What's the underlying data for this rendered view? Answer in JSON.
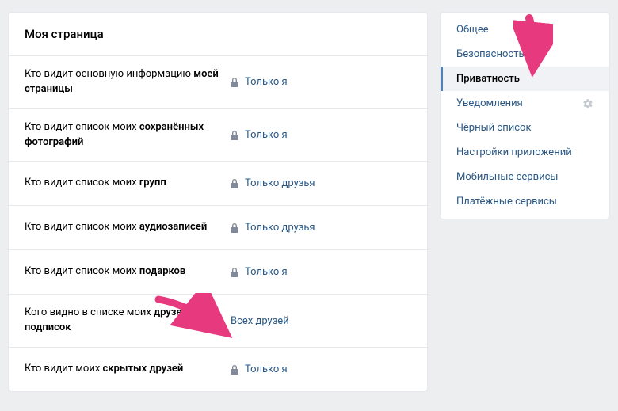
{
  "title": "Моя страница",
  "rows": [
    {
      "label_pre": "Кто видит основную информацию ",
      "label_strong": "моей страницы",
      "value": "Только я",
      "lock": true
    },
    {
      "label_pre": "Кто видит список моих ",
      "label_strong": "сохранённых фотографий",
      "value": "Только я",
      "lock": true
    },
    {
      "label_pre": "Кто видит список моих ",
      "label_strong": "групп",
      "value": "Только друзья",
      "lock": true
    },
    {
      "label_pre": "Кто видит список моих ",
      "label_strong": "аудиозаписей",
      "value": "Только друзья",
      "lock": true
    },
    {
      "label_pre": "Кто видит список моих ",
      "label_strong": "подарков",
      "value": "Только я",
      "lock": true
    },
    {
      "label_pre": "Кого видно в списке моих ",
      "label_strong": "друзей и подписок",
      "value": "Всех друзей",
      "lock": false
    },
    {
      "label_pre": "Кто видит моих ",
      "label_strong": "скрытых друзей",
      "value": "Только я",
      "lock": true
    }
  ],
  "sidebar": [
    {
      "label": "Общее",
      "active": false,
      "gear": false
    },
    {
      "label": "Безопасность",
      "active": false,
      "gear": false
    },
    {
      "label": "Приватность",
      "active": true,
      "gear": false
    },
    {
      "label": "Уведомления",
      "active": false,
      "gear": true
    },
    {
      "label": "Чёрный список",
      "active": false,
      "gear": false
    },
    {
      "label": "Настройки приложений",
      "active": false,
      "gear": false
    },
    {
      "label": "Мобильные сервисы",
      "active": false,
      "gear": false
    },
    {
      "label": "Платёжные сервисы",
      "active": false,
      "gear": false
    }
  ],
  "arrow_color": "#e6397e"
}
